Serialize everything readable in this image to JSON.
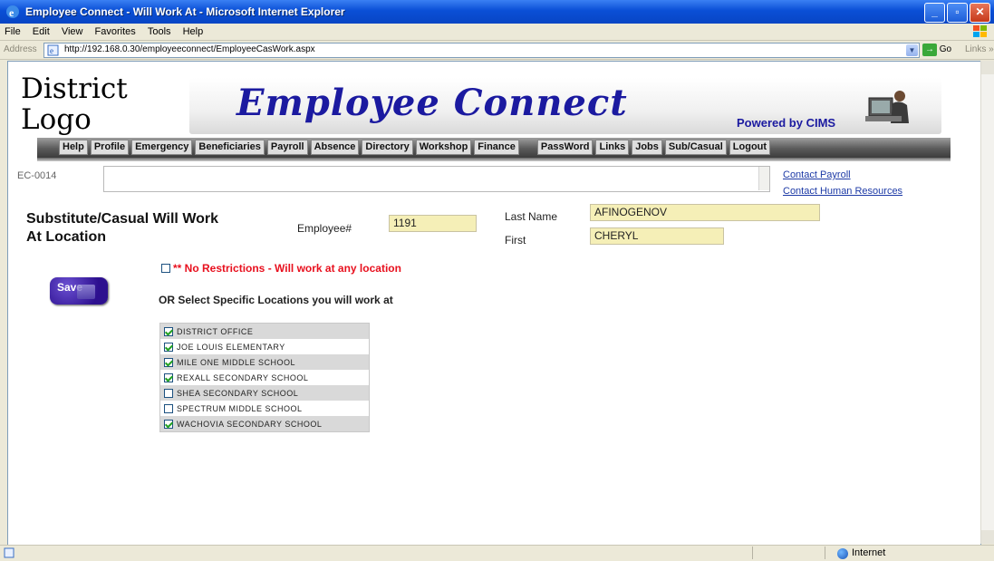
{
  "window": {
    "title": "Employee Connect - Will Work At - Microsoft Internet Explorer",
    "minimize": "_",
    "maximize": "▫",
    "close": "✕"
  },
  "menu": [
    "File",
    "Edit",
    "View",
    "Favorites",
    "Tools",
    "Help"
  ],
  "address": {
    "label": "Address",
    "url": "http://192.168.0.30/employeeconnect/EmployeeCasWork.aspx",
    "go": "Go",
    "links": "Links",
    "more": "»"
  },
  "header": {
    "logo_line1": "District",
    "logo_line2": "Logo",
    "app_title": "Employee Connect",
    "powered_by": "Powered by CIMS"
  },
  "nav": {
    "group1": [
      "Help",
      "Profile",
      "Emergency",
      "Beneficiaries",
      "Payroll",
      "Absence",
      "Directory",
      "Workshop",
      "Finance"
    ],
    "group2": [
      "PassWord",
      "Links",
      "Jobs",
      "Sub/Casual",
      "Logout"
    ]
  },
  "page_id": "EC-0014",
  "contacts": {
    "payroll": "Contact Payroll",
    "hr": "Contact Human Resources"
  },
  "form": {
    "heading_line1": "Substitute/Casual Will Work",
    "heading_line2": "At Location",
    "employee_label": "Employee#",
    "employee_value": "1191",
    "last_name_label": "Last Name",
    "last_name_value": "AFINOGENOV",
    "first_label": "First",
    "first_value": "CHERYL",
    "no_restrictions": "** No Restrictions - Will work at any location",
    "no_restrictions_checked": false,
    "save_label": "Save",
    "or_label": "OR Select Specific Locations you will work at",
    "locations": [
      {
        "name": "DISTRICT OFFICE",
        "checked": true
      },
      {
        "name": "JOE LOUIS ELEMENTARY",
        "checked": true
      },
      {
        "name": "MILE ONE MIDDLE SCHOOL",
        "checked": true
      },
      {
        "name": "REXALL SECONDARY SCHOOL",
        "checked": true
      },
      {
        "name": "SHEA SECONDARY SCHOOL",
        "checked": false
      },
      {
        "name": "SPECTRUM MIDDLE SCHOOL",
        "checked": false
      },
      {
        "name": "WACHOVIA SECONDARY SCHOOL",
        "checked": true
      }
    ]
  },
  "status": {
    "zone": "Internet"
  },
  "colors": {
    "title_bar": "#0a4fd6",
    "brand_blue": "#1b1aa0",
    "field_bg": "#f5efb7",
    "warning_red": "#e8101e",
    "save_button": "#2d108f"
  }
}
